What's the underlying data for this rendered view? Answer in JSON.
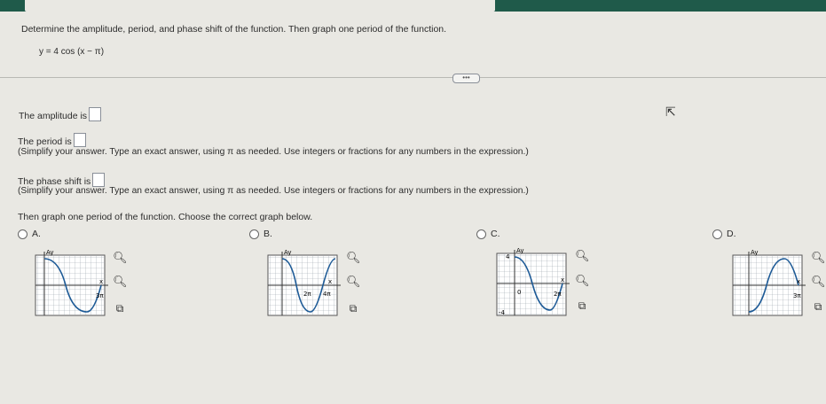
{
  "question": {
    "prompt": "Determine the amplitude, period, and phase shift of the function. Then graph one period of the function.",
    "equation": "y = 4 cos (x − π)"
  },
  "fields": {
    "amplitude_label": "The amplitude is",
    "period_label": "The period is",
    "period_hint": "(Simplify your answer. Type an exact answer, using π as needed. Use integers or fractions for any numbers in the expression.)",
    "phase_label": "The phase shift is",
    "phase_hint": "(Simplify your answer. Type an exact answer, using π as needed. Use integers or fractions for any numbers in the expression.)"
  },
  "graph_prompt": "Then graph one period of the function. Choose the correct graph below.",
  "options": [
    {
      "label": "A.",
      "ylabel": "Ay",
      "xlabel": "x",
      "tick": "3π"
    },
    {
      "label": "B.",
      "ylabel": "Ay",
      "xlabel": "x",
      "tick": "4π",
      "tick2": "2π"
    },
    {
      "label": "C.",
      "ylabel": "Ay",
      "xlabel": "x",
      "tick": "2π",
      "tick2": "0",
      "tick3": "4",
      "tick4": "-4"
    },
    {
      "label": "D.",
      "ylabel": "Ay",
      "xlabel": "x",
      "tick": "3π"
    }
  ],
  "more_button": "•••",
  "icons": {
    "zoom_in": "zoom-in-icon",
    "zoom_out": "zoom-out-icon",
    "popout": "popout-icon"
  }
}
